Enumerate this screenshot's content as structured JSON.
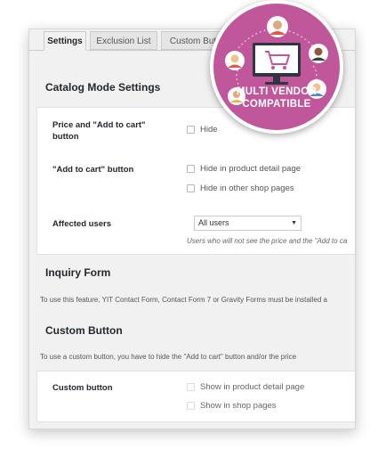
{
  "tabs": [
    {
      "label": "Settings",
      "active": true
    },
    {
      "label": "Exclusion List",
      "active": false
    },
    {
      "label": "Custom Button",
      "active": false
    }
  ],
  "catalog": {
    "heading": "Catalog Mode Settings",
    "price_label": "Price and \"Add to cart\" button",
    "price_option": "Hide",
    "addtocart_label": "\"Add to cart\" button",
    "addtocart_option_1": "Hide in product detail page",
    "addtocart_option_2": "Hide in other shop pages",
    "users_label": "Affected users",
    "users_value": "All users",
    "users_desc": "Users who will not see the price and the \"Add to ca"
  },
  "inquiry": {
    "heading": "Inquiry Form",
    "note": "To use this feature, YIT Contact Form, Contact Form 7 or Gravity Forms must be installed a"
  },
  "custom": {
    "heading": "Custom Button",
    "note": "To use a custom button, you have to hide the \"Add to cart\" button and/or the price",
    "label": "Custom button",
    "option_1": "Show in product detail page",
    "option_2": "Show in shop pages"
  },
  "badge": {
    "line1": "MULTI VENDOR",
    "line2": "COMPATIBLE",
    "color": "#c0579b",
    "icons": [
      "shopping-cart-icon",
      "monitor-icon",
      "user-avatar-icon"
    ]
  }
}
